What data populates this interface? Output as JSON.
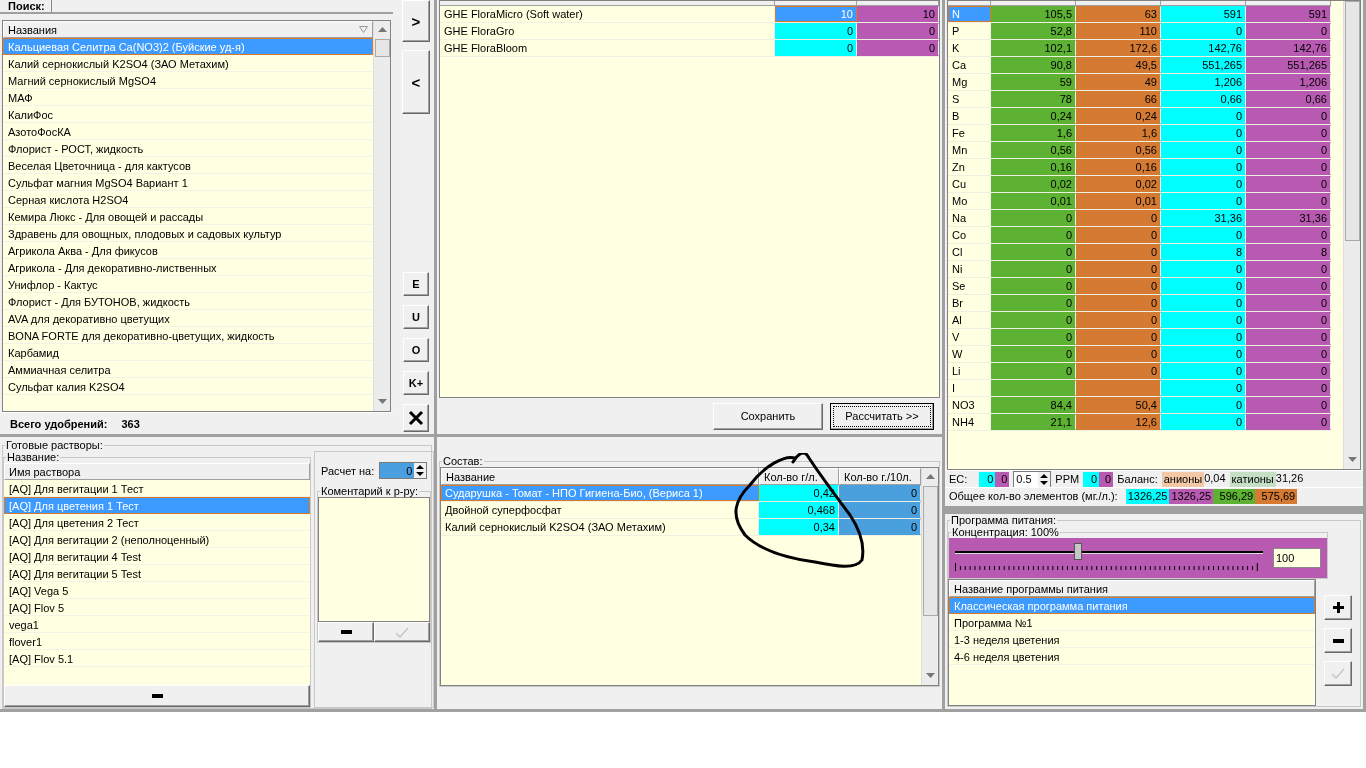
{
  "search": {
    "label": "Поиск:"
  },
  "fertilizers": {
    "column": "Названия",
    "total_label": "Всего удобрений:",
    "total": "363",
    "items": [
      {
        "name": "Кальциевая Селитра Ca(NO3)2 (Буйские уд-я)",
        "selected": true
      },
      {
        "name": "Калий  сернокислый  K2SO4 (ЗАО Метахим)",
        "selected": false
      },
      {
        "name": "Магний сернокислый MgSO4",
        "selected": false
      },
      {
        "name": "МАФ",
        "selected": false
      },
      {
        "name": "КалиФос",
        "selected": false
      },
      {
        "name": "АзотоФосКА",
        "selected": false
      },
      {
        "name": "Флорист - РОСТ, жидкость",
        "selected": false
      },
      {
        "name": "Веселая Цветочница - для кактусов",
        "selected": false
      },
      {
        "name": "Сульфат магния MgSO4 Вариант 1",
        "selected": false
      },
      {
        "name": "Серная кислота H2SO4",
        "selected": false
      },
      {
        "name": "Кемира Люкс - Для овощей и рассады",
        "selected": false
      },
      {
        "name": "Здравень для овощных, плодовых и садовых культур",
        "selected": false
      },
      {
        "name": "Агрикола Аква - Для фикусов",
        "selected": false
      },
      {
        "name": "Агрикола - Для декоративно-лиственных",
        "selected": false
      },
      {
        "name": "Унифлор - Кактус",
        "selected": false
      },
      {
        "name": "Флорист - Для БУТОНОВ, жидкость",
        "selected": false
      },
      {
        "name": "AVA для декоративно цветущих",
        "selected": false
      },
      {
        "name": "BONA FORTE для декоративно-цветущих, жидкость",
        "selected": false
      },
      {
        "name": "Карбамид",
        "selected": false
      },
      {
        "name": "Аммиачная селитра",
        "selected": false
      },
      {
        "name": "Сульфат калия K2SO4",
        "selected": false
      }
    ]
  },
  "move_buttons": [
    ">",
    "<"
  ],
  "tool_buttons": [
    "E",
    "U",
    "O",
    "K+"
  ],
  "selected_fertilizers": [
    {
      "name": "GHE FloraMicro (Soft water)",
      "values": [
        "10",
        "10"
      ],
      "selected": true
    },
    {
      "name": "GHE FloraGro",
      "values": [
        "0",
        "0"
      ],
      "selected": false
    },
    {
      "name": "GHE FloraBloom",
      "values": [
        "0",
        "0"
      ],
      "selected": false
    }
  ],
  "actions": [
    "Сохранить",
    "Рассчитать >>"
  ],
  "elements": {
    "columns": [
      {
        "color": "#5db233"
      },
      {
        "color": "#d57a33"
      },
      {
        "color": "#00ffff"
      },
      {
        "color": "#b95ab2"
      }
    ],
    "rows": [
      {
        "element": "N",
        "cells": {
          "column_1": "105,5",
          "column_2": "63",
          "column_3": "591",
          "column_4": "591"
        },
        "selected": true
      },
      {
        "element": "P",
        "cells": {
          "column_1": "52,8",
          "column_2": "110",
          "column_3": "0",
          "column_4": "0"
        },
        "selected": false
      },
      {
        "element": "K",
        "cells": {
          "column_1": "102,1",
          "column_2": "172,6",
          "column_3": "142,76",
          "column_4": "142,76"
        },
        "selected": false
      },
      {
        "element": "Ca",
        "cells": {
          "column_1": "90,8",
          "column_2": "49,5",
          "column_3": "551,265",
          "column_4": "551,265"
        },
        "selected": false
      },
      {
        "element": "Mg",
        "cells": {
          "column_1": "59",
          "column_2": "49",
          "column_3": "1,206",
          "column_4": "1,206"
        },
        "selected": false
      },
      {
        "element": "S",
        "cells": {
          "column_1": "78",
          "column_2": "66",
          "column_3": "0,66",
          "column_4": "0,66"
        },
        "selected": false
      },
      {
        "element": "B",
        "cells": {
          "column_1": "0,24",
          "column_2": "0,24",
          "column_3": "0",
          "column_4": "0"
        },
        "selected": false
      },
      {
        "element": "Fe",
        "cells": {
          "column_1": "1,6",
          "column_2": "1,6",
          "column_3": "0",
          "column_4": "0"
        },
        "selected": false
      },
      {
        "element": "Mn",
        "cells": {
          "column_1": "0,56",
          "column_2": "0,56",
          "column_3": "0",
          "column_4": "0"
        },
        "selected": false
      },
      {
        "element": "Zn",
        "cells": {
          "column_1": "0,16",
          "column_2": "0,16",
          "column_3": "0",
          "column_4": "0"
        },
        "selected": false
      },
      {
        "element": "Cu",
        "cells": {
          "column_1": "0,02",
          "column_2": "0,02",
          "column_3": "0",
          "column_4": "0"
        },
        "selected": false
      },
      {
        "element": "Mo",
        "cells": {
          "column_1": "0,01",
          "column_2": "0,01",
          "column_3": "0",
          "column_4": "0"
        },
        "selected": false
      },
      {
        "element": "Na",
        "cells": {
          "column_1": "0",
          "column_2": "0",
          "column_3": "31,36",
          "column_4": "31,36"
        },
        "selected": false
      },
      {
        "element": "Co",
        "cells": {
          "column_1": "0",
          "column_2": "0",
          "column_3": "0",
          "column_4": "0"
        },
        "selected": false
      },
      {
        "element": "Cl",
        "cells": {
          "column_1": "0",
          "column_2": "0",
          "column_3": "8",
          "column_4": "8"
        },
        "selected": false
      },
      {
        "element": "Ni",
        "cells": {
          "column_1": "0",
          "column_2": "0",
          "column_3": "0",
          "column_4": "0"
        },
        "selected": false
      },
      {
        "element": "Se",
        "cells": {
          "column_1": "0",
          "column_2": "0",
          "column_3": "0",
          "column_4": "0"
        },
        "selected": false
      },
      {
        "element": "Br",
        "cells": {
          "column_1": "0",
          "column_2": "0",
          "column_3": "0",
          "column_4": "0"
        },
        "selected": false
      },
      {
        "element": "Al",
        "cells": {
          "column_1": "0",
          "column_2": "0",
          "column_3": "0",
          "column_4": "0"
        },
        "selected": false
      },
      {
        "element": "V",
        "cells": {
          "column_1": "0",
          "column_2": "0",
          "column_3": "0",
          "column_4": "0"
        },
        "selected": false
      },
      {
        "element": "W",
        "cells": {
          "column_1": "0",
          "column_2": "0",
          "column_3": "0",
          "column_4": "0"
        },
        "selected": false
      },
      {
        "element": "Li",
        "cells": {
          "column_1": "0",
          "column_2": "0",
          "column_3": "0",
          "column_4": "0"
        },
        "selected": false
      },
      {
        "element": "I",
        "cells": {
          "column_3": "0",
          "column_4": "0"
        },
        "selected": false
      },
      {
        "element": "NO3",
        "cells": {
          "column_1": "84,4",
          "column_2": "50,4",
          "column_3": "0",
          "column_4": "0"
        },
        "selected": false
      },
      {
        "element": "NH4",
        "cells": {
          "column_1": "21,1",
          "column_2": "12,6",
          "column_3": "0",
          "column_4": "0"
        },
        "selected": false
      }
    ]
  },
  "ec": {
    "label": "EC:",
    "values": [
      "0",
      "0"
    ],
    "step": "0.5",
    "ppm_label": "PPM",
    "ppm_values": [
      "0",
      "0"
    ],
    "balance_label": "Баланс:",
    "anions_label": "анионы",
    "anions": "0,04",
    "cations_label": "катионы",
    "cations": "31,26"
  },
  "totals": {
    "label": "Общее кол-во элементов (мг./л.):",
    "values": [
      {
        "value": "1326,25",
        "color": "#00ffff"
      },
      {
        "value": "1326,25",
        "color": "#b95ab2"
      },
      {
        "value": "596,29",
        "color": "#5db233"
      },
      {
        "value": "575,69",
        "color": "#d57a33"
      }
    ]
  },
  "solutions": {
    "title": "Готовые растворы:",
    "group": "Название:",
    "column": "Имя раствора",
    "items": [
      {
        "name": "[AQ] Для вегитации 1 Тест",
        "selected": false
      },
      {
        "name": "[AQ] Для цветения 1 Тест",
        "selected": true
      },
      {
        "name": "[AQ] Для цветения 2 Тест",
        "selected": false
      },
      {
        "name": "[AQ] Для вегитации 2 (неполноценный)",
        "selected": false
      },
      {
        "name": "[AQ] Для вегитации 4 Test",
        "selected": false
      },
      {
        "name": "[AQ] Для вегитации 5 Test",
        "selected": false
      },
      {
        "name": "[AQ] Vega 5",
        "selected": false
      },
      {
        "name": "[AQ] Flov 5",
        "selected": false
      },
      {
        "name": "vega1",
        "selected": false
      },
      {
        "name": "flover1",
        "selected": false
      },
      {
        "name": "[AQ] Flov 5.1",
        "selected": false
      }
    ]
  },
  "calc": {
    "label": "Расчет на:",
    "value": "0",
    "comment_label": "Коментарий к р-ру:",
    "check_disabled": true
  },
  "composition": {
    "title": "Состав:",
    "columns": [
      "Название",
      "Кол-во г/л.",
      "Кол-во г./10л."
    ],
    "rows": [
      {
        "name": "Сударушка - Томат - НПО Гигиена-Био, (Вериса 1)",
        "values": [
          "0,42",
          "0"
        ],
        "selected": true
      },
      {
        "name": "Двойной суперфосфат",
        "values": [
          "0,468",
          "0"
        ],
        "selected": false
      },
      {
        "name": "Калий  сернокислый  K2SO4 (ЗАО Метахим)",
        "values": [
          "0,34",
          "0"
        ],
        "selected": false
      }
    ]
  },
  "program": {
    "title": "Программа питания:",
    "concentration_label": "Концентрация: 100%",
    "level": 0.4,
    "value": "100",
    "column": "Название программы питания",
    "check_disabled": true,
    "items": [
      {
        "name": "Классическая программа питания",
        "selected": true
      },
      {
        "name": "Программа №1",
        "selected": false
      },
      {
        "name": "1-3 неделя цветения",
        "selected": false
      },
      {
        "name": "4-6 неделя цветения",
        "selected": false
      }
    ]
  }
}
